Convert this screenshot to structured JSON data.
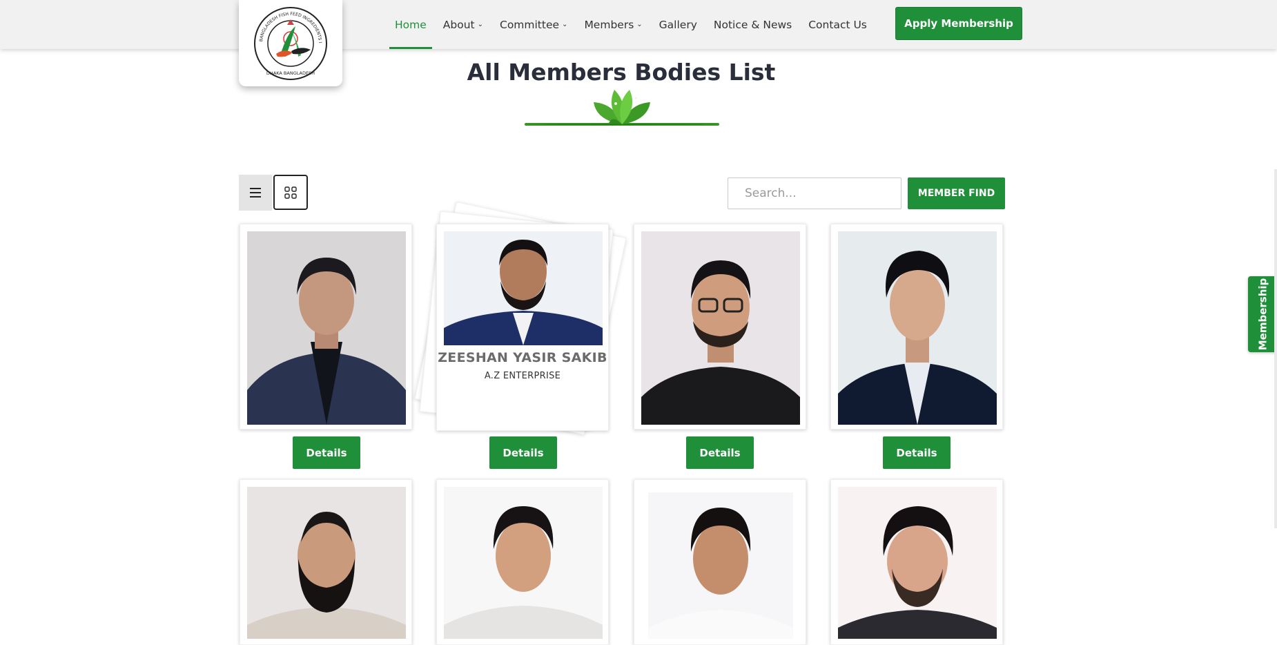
{
  "header": {
    "logo_texts": {
      "ring": "BANGLADESH FISH FEED INGREDIENTS IMPORTERS & TRADERS ASSOCIATION",
      "bottom": "DHAKA BANGLADESH"
    },
    "nav": [
      {
        "label": "Home",
        "active": true,
        "has_dropdown": false
      },
      {
        "label": "About",
        "active": false,
        "has_dropdown": true
      },
      {
        "label": "Committee",
        "active": false,
        "has_dropdown": true
      },
      {
        "label": "Members",
        "active": false,
        "has_dropdown": true
      },
      {
        "label": "Gallery",
        "active": false,
        "has_dropdown": false
      },
      {
        "label": "Notice & News",
        "active": false,
        "has_dropdown": false
      },
      {
        "label": "Contact Us",
        "active": false,
        "has_dropdown": false
      }
    ],
    "apply_label": "Apply Membership"
  },
  "page": {
    "title": "All Members Bodies List"
  },
  "toolbar": {
    "list_icon": "list-icon",
    "grid_icon": "grid-icon",
    "search_placeholder": "Search...",
    "search_value": "",
    "find_label": "MEMBER FIND"
  },
  "members": [
    {
      "details_label": "Details"
    },
    {
      "name": "ZEESHAN YASIR SAKIB",
      "organization": "A.Z ENTERPRISE",
      "details_label": "Details"
    },
    {
      "details_label": "Details"
    },
    {
      "details_label": "Details"
    },
    {},
    {},
    {},
    {}
  ],
  "side_tab": {
    "label": "Membership"
  },
  "colors": {
    "brand_green": "#1f8f3a",
    "header_bg": "#f2f1f1",
    "title_color": "#2a2d3a"
  }
}
